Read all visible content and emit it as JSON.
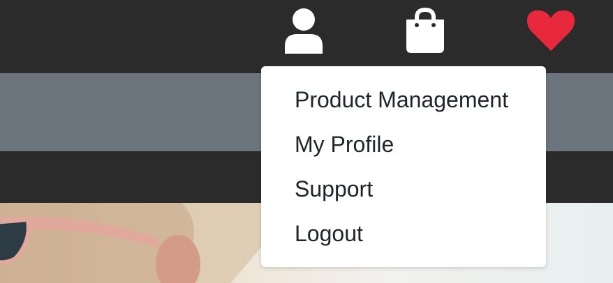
{
  "header": {
    "icons": {
      "account": "user-icon",
      "cart": "shopping-bag-icon",
      "wishlist": "heart-icon"
    },
    "colors": {
      "bar": "#2b2b2b",
      "icon": "#ffffff",
      "heart": "#e8283c",
      "band": "#6c757d"
    }
  },
  "account_menu": {
    "items": [
      {
        "label": "Product Management"
      },
      {
        "label": "My Profile"
      },
      {
        "label": "Support"
      },
      {
        "label": "Logout"
      }
    ]
  },
  "hero": {
    "image": "photo of a blonde woman wearing pink sunglasses"
  }
}
